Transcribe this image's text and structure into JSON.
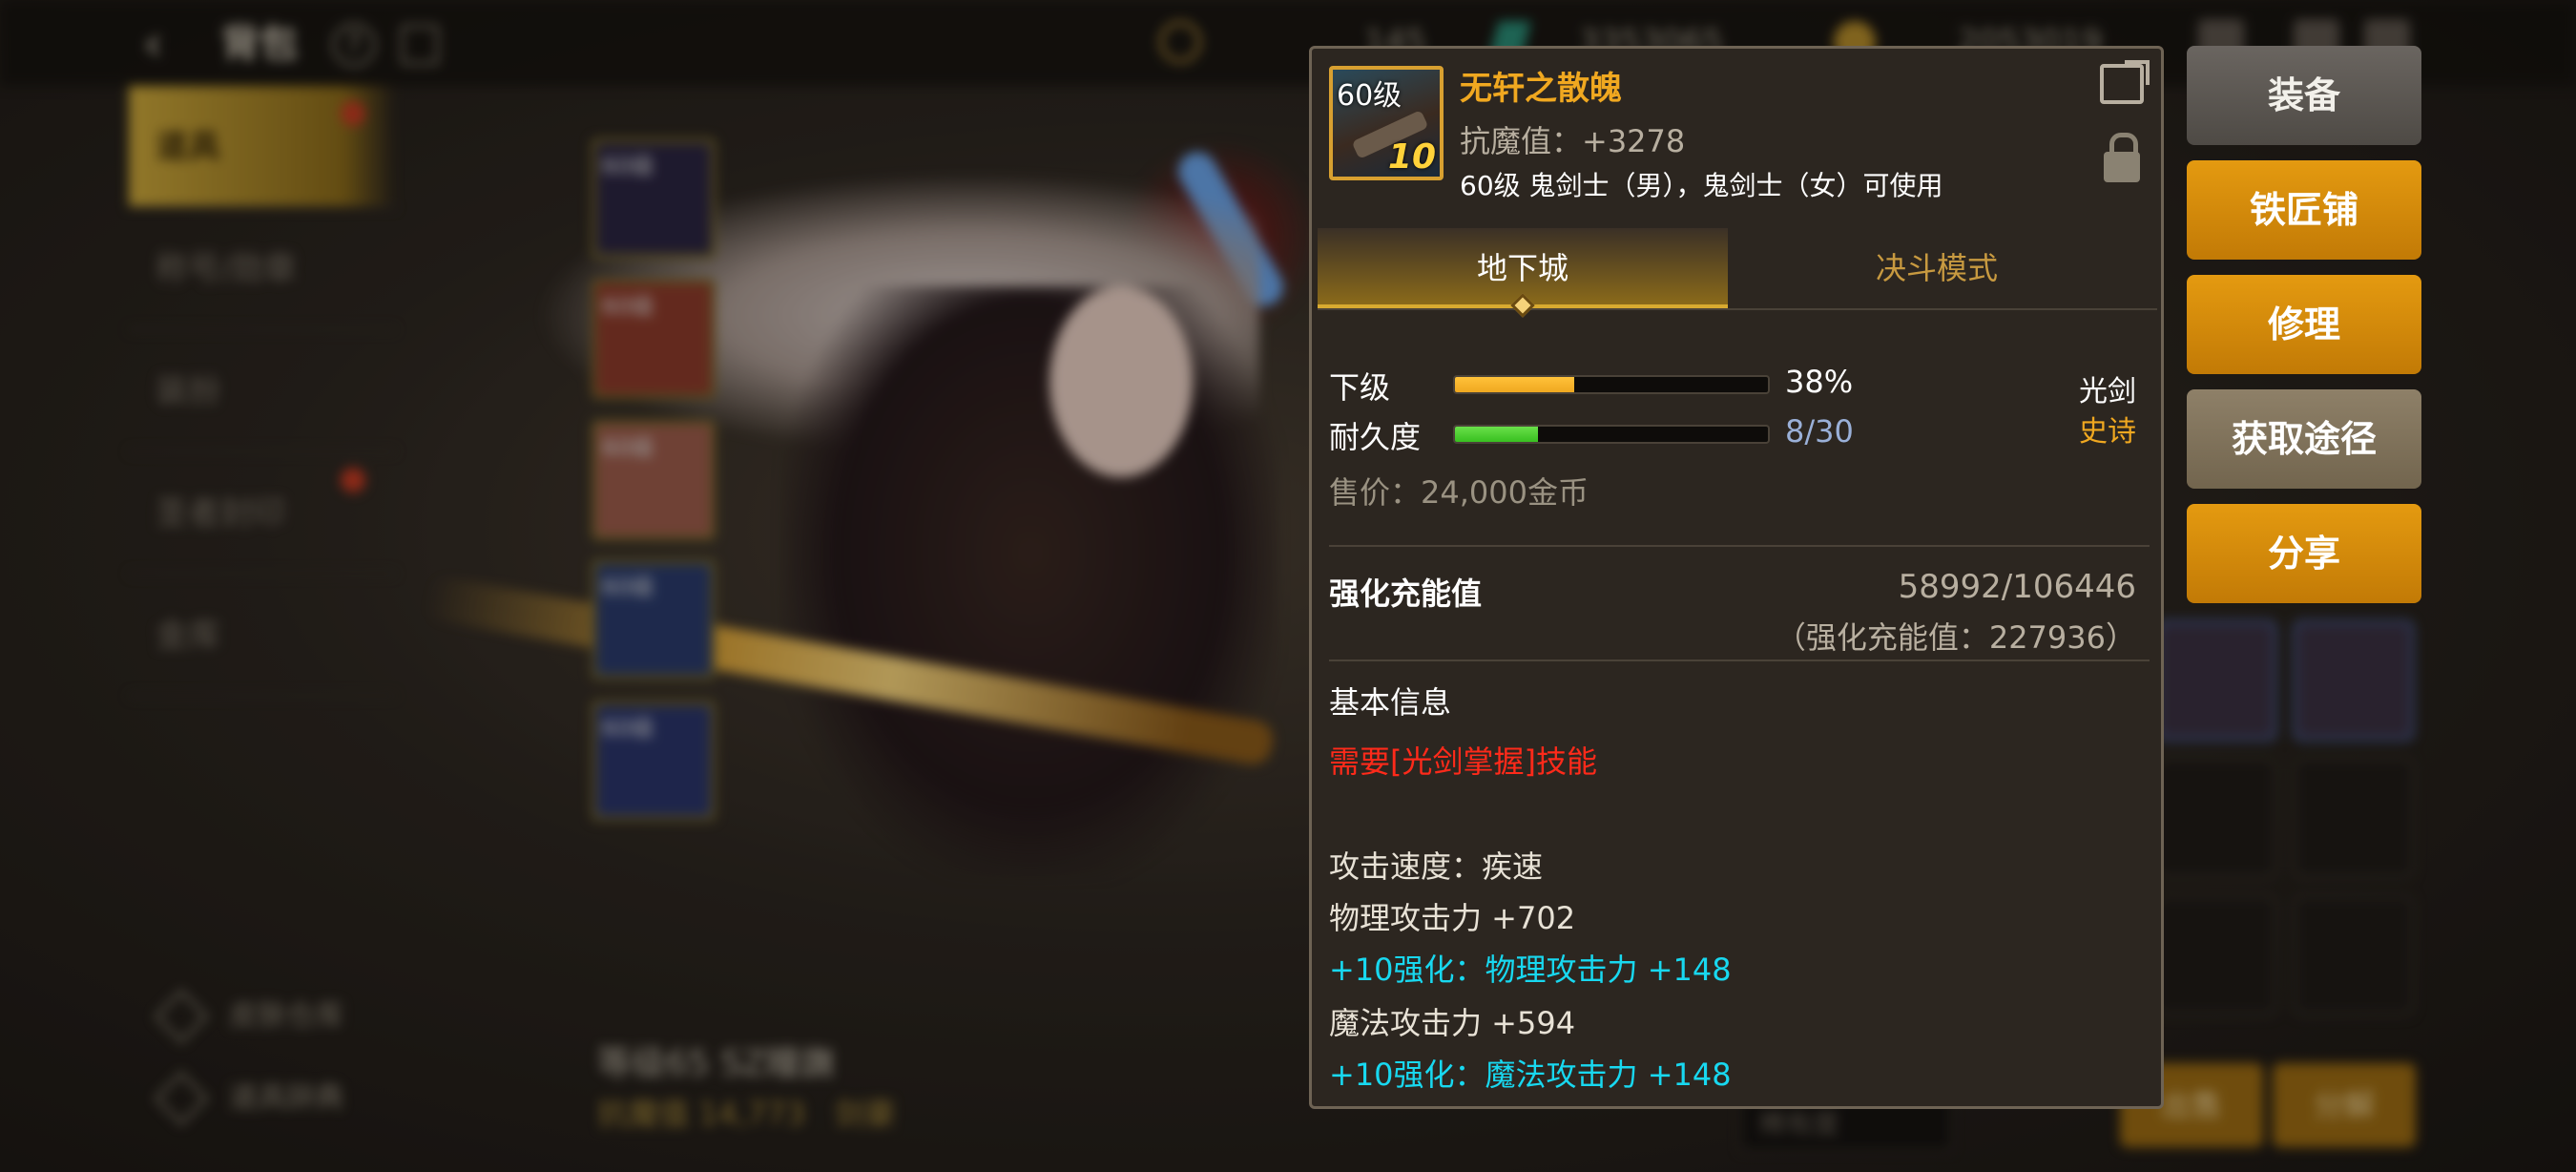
{
  "topbar": {
    "title": "背包",
    "currency_1": "145",
    "currency_2": "3353065",
    "currency_3": "2053019"
  },
  "sidebar": {
    "items": [
      {
        "label": "道具"
      },
      {
        "label": "称号/勋章"
      },
      {
        "label": "装扮"
      },
      {
        "label": "圣者封印"
      },
      {
        "label": "金库"
      }
    ]
  },
  "equip_slots": [
    {
      "label": "60级"
    },
    {
      "label": "60级"
    },
    {
      "label": "60级"
    },
    {
      "label": "60级"
    },
    {
      "label": "60级"
    }
  ],
  "bottom_left": {
    "skin_storage": "皮肤仓库",
    "item_dictionary": "道具辞典"
  },
  "character": {
    "level_name": "等级65 SZ瞳譕",
    "magic_resist": "抗魔值 14,773",
    "class": "剑豪"
  },
  "inventory": {
    "sell_label": "出售",
    "disassemble_label": "分解",
    "rarity_filter": "稀有度"
  },
  "tooltip": {
    "icon_level": "60级",
    "icon_enhance": "10",
    "name": "无轩之散魄",
    "magic_resist": "抗魔值：+3278",
    "usable_by": "60级 鬼剑士（男），鬼剑士（女）可使用",
    "tab_dungeon": "地下城",
    "tab_pvp": "决斗模式",
    "grade_label": "下级",
    "grade_value": "38%",
    "grade_percent": 38,
    "durability_label": "耐久度",
    "durability_value": "8/30",
    "durability_current": 8,
    "durability_max": 30,
    "weapon_type": "光剑",
    "rarity": "史诗",
    "sell_price": "售价：24,000金币",
    "amp_label": "强化充能值",
    "amp_value": "58992/106446",
    "amp_sub": "（强化充能值：227936）",
    "basic_info": "基本信息",
    "requirement": "需要[光剑掌握]技能",
    "attack_speed": "攻击速度：疾速",
    "phys_atk": "物理攻击力 +702",
    "phys_enh": "+10强化：物理攻击力 +148",
    "mag_atk": "魔法攻击力 +594",
    "mag_enh": "+10强化：魔法攻击力 +148"
  },
  "side_buttons": {
    "equip": "装备",
    "blacksmith": "铁匠铺",
    "repair": "修理",
    "obtain": "获取途径",
    "share": "分享"
  },
  "colors": {
    "item_name": "#f0a820",
    "enhance_text": "#18d8f0",
    "requirement": "#ff2a1a",
    "grade_bar": "#f0a820",
    "durability_bar": "#38c020",
    "button_gold": "#d8890c"
  }
}
